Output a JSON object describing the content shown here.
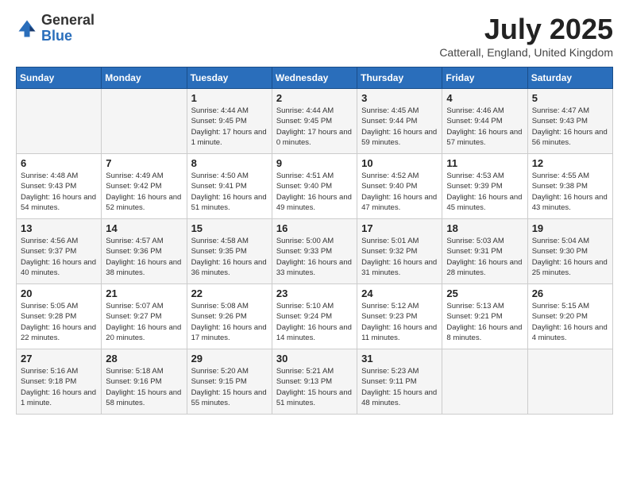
{
  "logo": {
    "general": "General",
    "blue": "Blue"
  },
  "title": "July 2025",
  "subtitle": "Catterall, England, United Kingdom",
  "days_of_week": [
    "Sunday",
    "Monday",
    "Tuesday",
    "Wednesday",
    "Thursday",
    "Friday",
    "Saturday"
  ],
  "weeks": [
    [
      {
        "day": "",
        "info": ""
      },
      {
        "day": "",
        "info": ""
      },
      {
        "day": "1",
        "info": "Sunrise: 4:44 AM\nSunset: 9:45 PM\nDaylight: 17 hours\nand 1 minute."
      },
      {
        "day": "2",
        "info": "Sunrise: 4:44 AM\nSunset: 9:45 PM\nDaylight: 17 hours\nand 0 minutes."
      },
      {
        "day": "3",
        "info": "Sunrise: 4:45 AM\nSunset: 9:44 PM\nDaylight: 16 hours\nand 59 minutes."
      },
      {
        "day": "4",
        "info": "Sunrise: 4:46 AM\nSunset: 9:44 PM\nDaylight: 16 hours\nand 57 minutes."
      },
      {
        "day": "5",
        "info": "Sunrise: 4:47 AM\nSunset: 9:43 PM\nDaylight: 16 hours\nand 56 minutes."
      }
    ],
    [
      {
        "day": "6",
        "info": "Sunrise: 4:48 AM\nSunset: 9:43 PM\nDaylight: 16 hours\nand 54 minutes."
      },
      {
        "day": "7",
        "info": "Sunrise: 4:49 AM\nSunset: 9:42 PM\nDaylight: 16 hours\nand 52 minutes."
      },
      {
        "day": "8",
        "info": "Sunrise: 4:50 AM\nSunset: 9:41 PM\nDaylight: 16 hours\nand 51 minutes."
      },
      {
        "day": "9",
        "info": "Sunrise: 4:51 AM\nSunset: 9:40 PM\nDaylight: 16 hours\nand 49 minutes."
      },
      {
        "day": "10",
        "info": "Sunrise: 4:52 AM\nSunset: 9:40 PM\nDaylight: 16 hours\nand 47 minutes."
      },
      {
        "day": "11",
        "info": "Sunrise: 4:53 AM\nSunset: 9:39 PM\nDaylight: 16 hours\nand 45 minutes."
      },
      {
        "day": "12",
        "info": "Sunrise: 4:55 AM\nSunset: 9:38 PM\nDaylight: 16 hours\nand 43 minutes."
      }
    ],
    [
      {
        "day": "13",
        "info": "Sunrise: 4:56 AM\nSunset: 9:37 PM\nDaylight: 16 hours\nand 40 minutes."
      },
      {
        "day": "14",
        "info": "Sunrise: 4:57 AM\nSunset: 9:36 PM\nDaylight: 16 hours\nand 38 minutes."
      },
      {
        "day": "15",
        "info": "Sunrise: 4:58 AM\nSunset: 9:35 PM\nDaylight: 16 hours\nand 36 minutes."
      },
      {
        "day": "16",
        "info": "Sunrise: 5:00 AM\nSunset: 9:33 PM\nDaylight: 16 hours\nand 33 minutes."
      },
      {
        "day": "17",
        "info": "Sunrise: 5:01 AM\nSunset: 9:32 PM\nDaylight: 16 hours\nand 31 minutes."
      },
      {
        "day": "18",
        "info": "Sunrise: 5:03 AM\nSunset: 9:31 PM\nDaylight: 16 hours\nand 28 minutes."
      },
      {
        "day": "19",
        "info": "Sunrise: 5:04 AM\nSunset: 9:30 PM\nDaylight: 16 hours\nand 25 minutes."
      }
    ],
    [
      {
        "day": "20",
        "info": "Sunrise: 5:05 AM\nSunset: 9:28 PM\nDaylight: 16 hours\nand 22 minutes."
      },
      {
        "day": "21",
        "info": "Sunrise: 5:07 AM\nSunset: 9:27 PM\nDaylight: 16 hours\nand 20 minutes."
      },
      {
        "day": "22",
        "info": "Sunrise: 5:08 AM\nSunset: 9:26 PM\nDaylight: 16 hours\nand 17 minutes."
      },
      {
        "day": "23",
        "info": "Sunrise: 5:10 AM\nSunset: 9:24 PM\nDaylight: 16 hours\nand 14 minutes."
      },
      {
        "day": "24",
        "info": "Sunrise: 5:12 AM\nSunset: 9:23 PM\nDaylight: 16 hours\nand 11 minutes."
      },
      {
        "day": "25",
        "info": "Sunrise: 5:13 AM\nSunset: 9:21 PM\nDaylight: 16 hours\nand 8 minutes."
      },
      {
        "day": "26",
        "info": "Sunrise: 5:15 AM\nSunset: 9:20 PM\nDaylight: 16 hours\nand 4 minutes."
      }
    ],
    [
      {
        "day": "27",
        "info": "Sunrise: 5:16 AM\nSunset: 9:18 PM\nDaylight: 16 hours\nand 1 minute."
      },
      {
        "day": "28",
        "info": "Sunrise: 5:18 AM\nSunset: 9:16 PM\nDaylight: 15 hours\nand 58 minutes."
      },
      {
        "day": "29",
        "info": "Sunrise: 5:20 AM\nSunset: 9:15 PM\nDaylight: 15 hours\nand 55 minutes."
      },
      {
        "day": "30",
        "info": "Sunrise: 5:21 AM\nSunset: 9:13 PM\nDaylight: 15 hours\nand 51 minutes."
      },
      {
        "day": "31",
        "info": "Sunrise: 5:23 AM\nSunset: 9:11 PM\nDaylight: 15 hours\nand 48 minutes."
      },
      {
        "day": "",
        "info": ""
      },
      {
        "day": "",
        "info": ""
      }
    ]
  ],
  "gray_rows": [
    0,
    2,
    4
  ]
}
